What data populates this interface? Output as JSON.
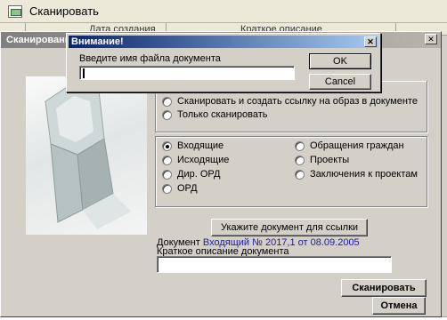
{
  "app": {
    "title": "Сканировать"
  },
  "grid": {
    "col_date": "Дата создания",
    "col_desc": "Краткое описание"
  },
  "scan_dialog": {
    "title": "Сканирование",
    "close_glyph": "✕",
    "mode_options": [
      {
        "label": "Сканировать и создать ссылку на образ в документе",
        "selected": false
      },
      {
        "label": "Только сканировать",
        "selected": false
      }
    ],
    "type_options": [
      {
        "label": "Входящие",
        "selected": true
      },
      {
        "label": "Исходящие",
        "selected": false
      },
      {
        "label": "Дир. ОРД",
        "selected": false
      },
      {
        "label": "ОРД",
        "selected": false
      },
      {
        "label": "Обращения граждан",
        "selected": false
      },
      {
        "label": "Проекты",
        "selected": false
      },
      {
        "label": "Заключения к проектам",
        "selected": false
      }
    ],
    "ref_button": "Укажите документ для ссылки",
    "doc_prefix": "Документ",
    "doc_link": "Входящий № 2017,1 от 08.09.2005",
    "desc_label": "Краткое описание документа",
    "desc_value": "",
    "scan_button": "Сканировать",
    "cancel_button": "Отмена"
  },
  "alert": {
    "title": "Внимание!",
    "close_glyph": "✕",
    "prompt": "Введите имя файла документа",
    "input_value": "",
    "ok_button": "OK",
    "cancel_button": "Cancel"
  },
  "colors": {
    "alert_title_bar": "#0a246a",
    "window_face": "#d4d0c8",
    "link_color": "#1a1aa8"
  }
}
